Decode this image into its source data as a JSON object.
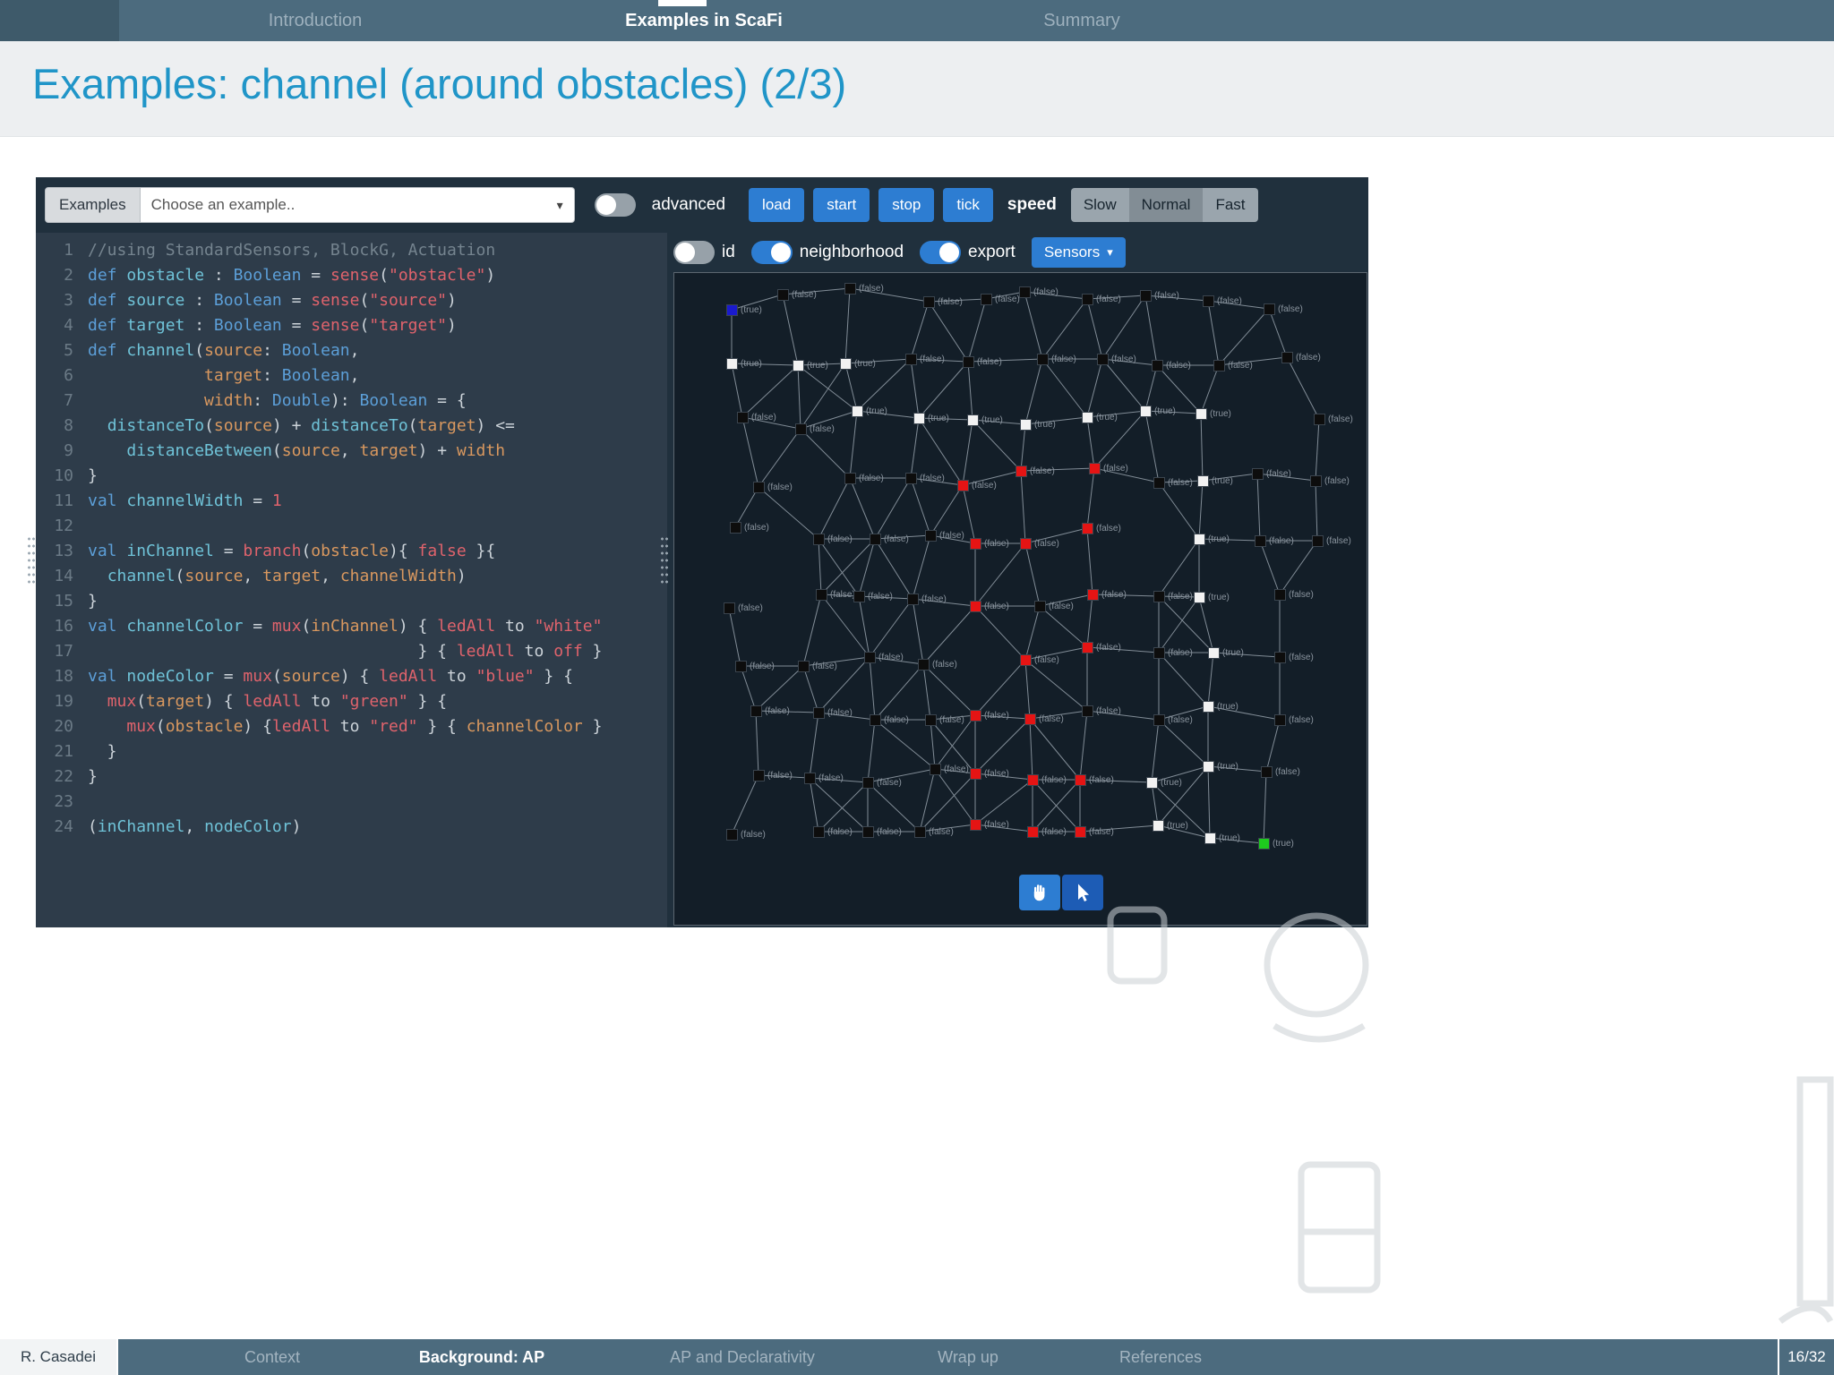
{
  "topbar": {
    "tabs": [
      {
        "label": "Introduction",
        "active": false
      },
      {
        "label": "Examples in ScaFi",
        "active": true
      },
      {
        "label": "Summary",
        "active": false
      }
    ]
  },
  "title": "Examples: channel (around obstacles) (2/3)",
  "playground": {
    "toolbar": {
      "examples_label": "Examples",
      "select_text": "Choose an example..",
      "advanced_label": "advanced",
      "advanced_on": false,
      "buttons": [
        "load",
        "start",
        "stop",
        "tick"
      ],
      "speed_label": "speed",
      "speed_options": [
        "Slow",
        "Normal",
        "Fast"
      ],
      "speed_selected": "Normal"
    },
    "controls": {
      "id_label": "id",
      "id_on": false,
      "neighborhood_label": "neighborhood",
      "neighborhood_on": true,
      "export_label": "export",
      "export_on": true,
      "sensors_label": "Sensors"
    },
    "code": {
      "lines": [
        [
          [
            "c",
            "//using StandardSensors, BlockG, Actuation"
          ]
        ],
        [
          [
            "k",
            "def "
          ],
          [
            "i",
            "obstacle"
          ],
          [
            "p",
            " : "
          ],
          [
            "t",
            "Boolean"
          ],
          [
            "p",
            " = "
          ],
          [
            "f",
            "sense"
          ],
          [
            "p",
            "("
          ],
          [
            "s",
            "\"obstacle\""
          ],
          [
            "p",
            ")"
          ]
        ],
        [
          [
            "k",
            "def "
          ],
          [
            "i",
            "source"
          ],
          [
            "p",
            " : "
          ],
          [
            "t",
            "Boolean"
          ],
          [
            "p",
            " = "
          ],
          [
            "f",
            "sense"
          ],
          [
            "p",
            "("
          ],
          [
            "s",
            "\"source\""
          ],
          [
            "p",
            ")"
          ]
        ],
        [
          [
            "k",
            "def "
          ],
          [
            "i",
            "target"
          ],
          [
            "p",
            " : "
          ],
          [
            "t",
            "Boolean"
          ],
          [
            "p",
            " = "
          ],
          [
            "f",
            "sense"
          ],
          [
            "p",
            "("
          ],
          [
            "s",
            "\"target\""
          ],
          [
            "p",
            ")"
          ]
        ],
        [
          [
            "k",
            "def "
          ],
          [
            "i",
            "channel"
          ],
          [
            "p",
            "("
          ],
          [
            "o",
            "source"
          ],
          [
            "p",
            ": "
          ],
          [
            "t",
            "Boolean"
          ],
          [
            "p",
            ","
          ]
        ],
        [
          [
            "p",
            "            "
          ],
          [
            "o",
            "target"
          ],
          [
            "p",
            ": "
          ],
          [
            "t",
            "Boolean"
          ],
          [
            "p",
            ","
          ]
        ],
        [
          [
            "p",
            "            "
          ],
          [
            "o",
            "width"
          ],
          [
            "p",
            ": "
          ],
          [
            "t",
            "Double"
          ],
          [
            "p",
            "): "
          ],
          [
            "t",
            "Boolean"
          ],
          [
            "p",
            " = {"
          ]
        ],
        [
          [
            "p",
            "  "
          ],
          [
            "d",
            "distanceTo"
          ],
          [
            "p",
            "("
          ],
          [
            "o",
            "source"
          ],
          [
            "p",
            ") + "
          ],
          [
            "d",
            "distanceTo"
          ],
          [
            "p",
            "("
          ],
          [
            "o",
            "target"
          ],
          [
            "p",
            ") <="
          ]
        ],
        [
          [
            "p",
            "    "
          ],
          [
            "d",
            "distanceBetween"
          ],
          [
            "p",
            "("
          ],
          [
            "o",
            "source"
          ],
          [
            "p",
            ", "
          ],
          [
            "o",
            "target"
          ],
          [
            "p",
            ") + "
          ],
          [
            "o",
            "width"
          ]
        ],
        [
          [
            "p",
            "}"
          ]
        ],
        [
          [
            "k",
            "val "
          ],
          [
            "i",
            "channelWidth"
          ],
          [
            "p",
            " = "
          ],
          [
            "n",
            "1"
          ]
        ],
        [],
        [
          [
            "k",
            "val "
          ],
          [
            "i",
            "inChannel"
          ],
          [
            "p",
            " = "
          ],
          [
            "f",
            "branch"
          ],
          [
            "p",
            "("
          ],
          [
            "o",
            "obstacle"
          ],
          [
            "p",
            "){ "
          ],
          [
            "f",
            "false"
          ],
          [
            "p",
            " }{"
          ]
        ],
        [
          [
            "p",
            "  "
          ],
          [
            "d",
            "channel"
          ],
          [
            "p",
            "("
          ],
          [
            "o",
            "source"
          ],
          [
            "p",
            ", "
          ],
          [
            "o",
            "target"
          ],
          [
            "p",
            ", "
          ],
          [
            "o",
            "channelWidth"
          ],
          [
            "p",
            ")"
          ]
        ],
        [
          [
            "p",
            "}"
          ]
        ],
        [
          [
            "k",
            "val "
          ],
          [
            "i",
            "channelColor"
          ],
          [
            "p",
            " = "
          ],
          [
            "f",
            "mux"
          ],
          [
            "p",
            "("
          ],
          [
            "o",
            "inChannel"
          ],
          [
            "p",
            ") { "
          ],
          [
            "f",
            "ledAll"
          ],
          [
            "p",
            " to "
          ],
          [
            "s",
            "\"white\""
          ]
        ],
        [
          [
            "p",
            "                                  } { "
          ],
          [
            "f",
            "ledAll"
          ],
          [
            "p",
            " to "
          ],
          [
            "f",
            "off"
          ],
          [
            "p",
            " }"
          ]
        ],
        [
          [
            "k",
            "val "
          ],
          [
            "i",
            "nodeColor"
          ],
          [
            "p",
            " = "
          ],
          [
            "f",
            "mux"
          ],
          [
            "p",
            "("
          ],
          [
            "o",
            "source"
          ],
          [
            "p",
            ") { "
          ],
          [
            "f",
            "ledAll"
          ],
          [
            "p",
            " to "
          ],
          [
            "s",
            "\"blue\""
          ],
          [
            "p",
            " } {"
          ]
        ],
        [
          [
            "p",
            "  "
          ],
          [
            "f",
            "mux"
          ],
          [
            "p",
            "("
          ],
          [
            "o",
            "target"
          ],
          [
            "p",
            ") { "
          ],
          [
            "f",
            "ledAll"
          ],
          [
            "p",
            " to "
          ],
          [
            "s",
            "\"green\""
          ],
          [
            "p",
            " } {"
          ]
        ],
        [
          [
            "p",
            "    "
          ],
          [
            "f",
            "mux"
          ],
          [
            "p",
            "("
          ],
          [
            "o",
            "obstacle"
          ],
          [
            "p",
            ") {"
          ],
          [
            "f",
            "ledAll"
          ],
          [
            "p",
            " to "
          ],
          [
            "s",
            "\"red\""
          ],
          [
            "p",
            " } { "
          ],
          [
            "o",
            "channelColor"
          ],
          [
            "p",
            " }"
          ]
        ],
        [
          [
            "p",
            "  }"
          ]
        ],
        [
          [
            "p",
            "}"
          ]
        ],
        [],
        [
          [
            "p",
            "("
          ],
          [
            "i",
            "inChannel"
          ],
          [
            "p",
            ", "
          ],
          [
            "i",
            "nodeColor"
          ],
          [
            "p",
            ")"
          ]
        ]
      ]
    },
    "graph": {
      "node_colors": {
        "b": "#0d0d0d",
        "w": "#f2f2f2",
        "r": "#e51414",
        "u": "#1a1acd",
        "g": "#1ecb1e"
      },
      "node_color_names": {
        "b": "device",
        "w": "channel",
        "r": "obstacle",
        "u": "source",
        "g": "target"
      },
      "edge_color": "#818c96",
      "nodes": [
        [
          58,
          35,
          "u",
          "(true)"
        ],
        [
          115,
          18,
          "b",
          "(false)"
        ],
        [
          190,
          11,
          "b",
          "(false)"
        ],
        [
          278,
          26,
          "b",
          "(false)"
        ],
        [
          342,
          23,
          "b",
          "(false)"
        ],
        [
          385,
          15,
          "b",
          "(false)"
        ],
        [
          455,
          23,
          "b",
          "(false)"
        ],
        [
          520,
          19,
          "b",
          "(false)"
        ],
        [
          590,
          25,
          "b",
          "(false)"
        ],
        [
          658,
          34,
          "b",
          "(false)"
        ],
        [
          58,
          95,
          "w",
          "(true)"
        ],
        [
          132,
          97,
          "w",
          "(true)"
        ],
        [
          185,
          95,
          "w",
          "(true)"
        ],
        [
          258,
          90,
          "b",
          "(false)"
        ],
        [
          322,
          93,
          "b",
          "(false)"
        ],
        [
          405,
          90,
          "b",
          "(false)"
        ],
        [
          472,
          90,
          "b",
          "(false)"
        ],
        [
          533,
          97,
          "b",
          "(false)"
        ],
        [
          602,
          97,
          "b",
          "(false)"
        ],
        [
          678,
          88,
          "b",
          "(false)"
        ],
        [
          70,
          155,
          "b",
          "(false)"
        ],
        [
          135,
          168,
          "b",
          "(false)"
        ],
        [
          198,
          148,
          "w",
          "(true)"
        ],
        [
          267,
          156,
          "w",
          "(true)"
        ],
        [
          327,
          158,
          "w",
          "(true)"
        ],
        [
          386,
          163,
          "w",
          "(true)"
        ],
        [
          455,
          155,
          "w",
          "(true)"
        ],
        [
          520,
          148,
          "w",
          "(true)"
        ],
        [
          582,
          151,
          "w",
          "(true)"
        ],
        [
          714,
          157,
          "b",
          "(false)"
        ],
        [
          88,
          233,
          "b",
          "(false)"
        ],
        [
          190,
          223,
          "b",
          "(false)"
        ],
        [
          258,
          223,
          "b",
          "(false)"
        ],
        [
          316,
          231,
          "r",
          "(false)"
        ],
        [
          381,
          215,
          "r",
          "(false)"
        ],
        [
          463,
          212,
          "r",
          "(false)"
        ],
        [
          535,
          228,
          "b",
          "(false)"
        ],
        [
          584,
          226,
          "w",
          "(true)"
        ],
        [
          645,
          218,
          "b",
          "(false)"
        ],
        [
          710,
          226,
          "b",
          "(false)"
        ],
        [
          62,
          278,
          "b",
          "(false)"
        ],
        [
          155,
          291,
          "b",
          "(false)"
        ],
        [
          218,
          291,
          "b",
          "(false)"
        ],
        [
          280,
          287,
          "b",
          "(false)"
        ],
        [
          330,
          296,
          "r",
          "(false)"
        ],
        [
          386,
          296,
          "r",
          "(false)"
        ],
        [
          455,
          279,
          "r",
          "(false)"
        ],
        [
          580,
          291,
          "w",
          "(true)"
        ],
        [
          648,
          293,
          "b",
          "(false)"
        ],
        [
          712,
          293,
          "b",
          "(false)"
        ],
        [
          55,
          368,
          "b",
          "(false)"
        ],
        [
          158,
          353,
          "b",
          "(false)"
        ],
        [
          200,
          355,
          "b",
          "(false)"
        ],
        [
          260,
          358,
          "b",
          "(false)"
        ],
        [
          330,
          366,
          "r",
          "(false)"
        ],
        [
          402,
          366,
          "b",
          "(false)"
        ],
        [
          461,
          353,
          "r",
          "(false)"
        ],
        [
          535,
          355,
          "b",
          "(false)"
        ],
        [
          580,
          356,
          "w",
          "(true)"
        ],
        [
          670,
          353,
          "b",
          "(false)"
        ],
        [
          68,
          433,
          "b",
          "(false)"
        ],
        [
          138,
          433,
          "b",
          "(false)"
        ],
        [
          212,
          423,
          "b",
          "(false)"
        ],
        [
          272,
          431,
          "b",
          "(false)"
        ],
        [
          386,
          426,
          "r",
          "(false)"
        ],
        [
          455,
          412,
          "r",
          "(false)"
        ],
        [
          535,
          418,
          "b",
          "(false)"
        ],
        [
          596,
          418,
          "w",
          "(true)"
        ],
        [
          670,
          423,
          "b",
          "(false)"
        ],
        [
          85,
          483,
          "b",
          "(false)"
        ],
        [
          155,
          485,
          "b",
          "(false)"
        ],
        [
          218,
          493,
          "b",
          "(false)"
        ],
        [
          280,
          493,
          "b",
          "(false)"
        ],
        [
          330,
          488,
          "r",
          "(false)"
        ],
        [
          391,
          492,
          "r",
          "(false)"
        ],
        [
          455,
          483,
          "b",
          "(false)"
        ],
        [
          535,
          493,
          "b",
          "(false)"
        ],
        [
          590,
          478,
          "w",
          "(true)"
        ],
        [
          670,
          493,
          "b",
          "(false)"
        ],
        [
          88,
          555,
          "b",
          "(false)"
        ],
        [
          145,
          558,
          "b",
          "(false)"
        ],
        [
          210,
          563,
          "b",
          "(false)"
        ],
        [
          285,
          548,
          "b",
          "(false)"
        ],
        [
          330,
          553,
          "r",
          "(false)"
        ],
        [
          394,
          560,
          "r",
          "(false)"
        ],
        [
          447,
          560,
          "r",
          "(false)"
        ],
        [
          527,
          563,
          "w",
          "(true)"
        ],
        [
          590,
          545,
          "w",
          "(true)"
        ],
        [
          655,
          551,
          "b",
          "(false)"
        ],
        [
          58,
          621,
          "b",
          "(false)"
        ],
        [
          155,
          618,
          "b",
          "(false)"
        ],
        [
          210,
          618,
          "b",
          "(false)"
        ],
        [
          268,
          618,
          "b",
          "(false)"
        ],
        [
          330,
          610,
          "r",
          "(false)"
        ],
        [
          394,
          618,
          "r",
          "(false)"
        ],
        [
          447,
          618,
          "r",
          "(false)"
        ],
        [
          534,
          611,
          "w",
          "(true)"
        ],
        [
          592,
          625,
          "w",
          "(true)"
        ],
        [
          652,
          631,
          "g",
          "(true)"
        ]
      ]
    }
  },
  "footer": {
    "author": "R. Casadei",
    "sections": [
      {
        "label": "Context",
        "active": false
      },
      {
        "label": "Background: AP",
        "active": true
      },
      {
        "label": "AP and Declarativity",
        "active": false
      },
      {
        "label": "Wrap up",
        "active": false
      },
      {
        "label": "References",
        "active": false
      }
    ],
    "page": "16/32"
  },
  "colors": {
    "accent_blue": "#2d7dd2",
    "title_blue": "#2095c8",
    "bar_slate": "#4c6b7e",
    "editor_bg": "#2e3c4a",
    "graph_bg": "#131e28"
  }
}
